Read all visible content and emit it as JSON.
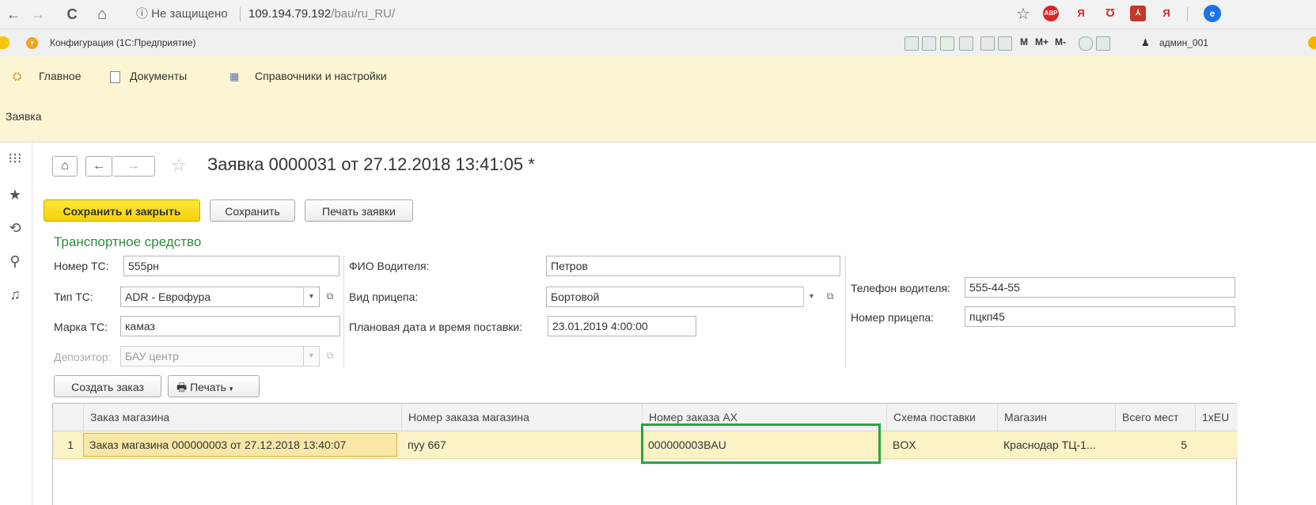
{
  "browser": {
    "back": "←",
    "forward": "→",
    "reload": "C",
    "home": "⌂",
    "security_icon": "ⓘ",
    "security_label": "Не защищено",
    "url_host": "109.194.79.192",
    "url_path": "/bau/ru_RU/",
    "star": "☆",
    "ext_abp": "ABP",
    "ext_ya": "Я",
    "ext_pocket": "Ʊ",
    "ext_pdf": "⅄",
    "ext_ya2": "Я",
    "avatar": "e"
  },
  "app": {
    "title": "Конфигурация  (1С:Предприятие)",
    "tb_m": "M",
    "tb_mplus": "M+",
    "tb_mminus": "M-",
    "user": "админ_001"
  },
  "sections": {
    "items": [
      {
        "label": "Главное"
      },
      {
        "label": "Документы"
      },
      {
        "label": "Справочники и настройки"
      }
    ],
    "open_title": "Заявка"
  },
  "form": {
    "title": "Заявка 0000031 от 27.12.2018 13:41:05 *",
    "buttons": {
      "save_close": "Сохранить и закрыть",
      "save": "Сохранить",
      "print_request": "Печать заявки"
    },
    "group_title": "Транспортное средство",
    "fields": {
      "vehicle_number": {
        "label": "Номер ТС:",
        "value": "555рн"
      },
      "vehicle_type": {
        "label": "Тип ТС:",
        "value": "ADR - Еврофура"
      },
      "vehicle_brand": {
        "label": "Марка ТС:",
        "value": "камаз"
      },
      "depositor": {
        "label": "Депозитор:",
        "value": "БАУ центр"
      },
      "driver_name": {
        "label": "ФИО Водителя:",
        "value": "Петров"
      },
      "trailer_type": {
        "label": "Вид прицепа:",
        "value": "Бортовой"
      },
      "planned_date": {
        "label": "Плановая дата и время поставки:",
        "value": "23.01.2019  4:00:00"
      },
      "driver_phone": {
        "label": "Телефон водителя:",
        "value": "555-44-55"
      },
      "trailer_number": {
        "label": "Номер прицепа:",
        "value": "пцкп45"
      }
    },
    "table_buttons": {
      "create_order": "Создать заказ",
      "print": "Печать"
    },
    "table": {
      "columns": [
        "Заказ магазина",
        "Номер заказа магазина",
        "Номер заказа АХ",
        "Схема поставки",
        "Магазин",
        "Всего мест",
        "1хEU"
      ],
      "rows": [
        {
          "n": "1",
          "order": "Заказ магазина 000000003 от 27.12.2018 13:40:07",
          "shop_order_no": "пуу 667",
          "ax_order_no": "000000003BAU",
          "scheme": "BOX",
          "shop": "Краснодар ТЦ-1...",
          "total_places": "5",
          "eu": ""
        }
      ]
    }
  }
}
